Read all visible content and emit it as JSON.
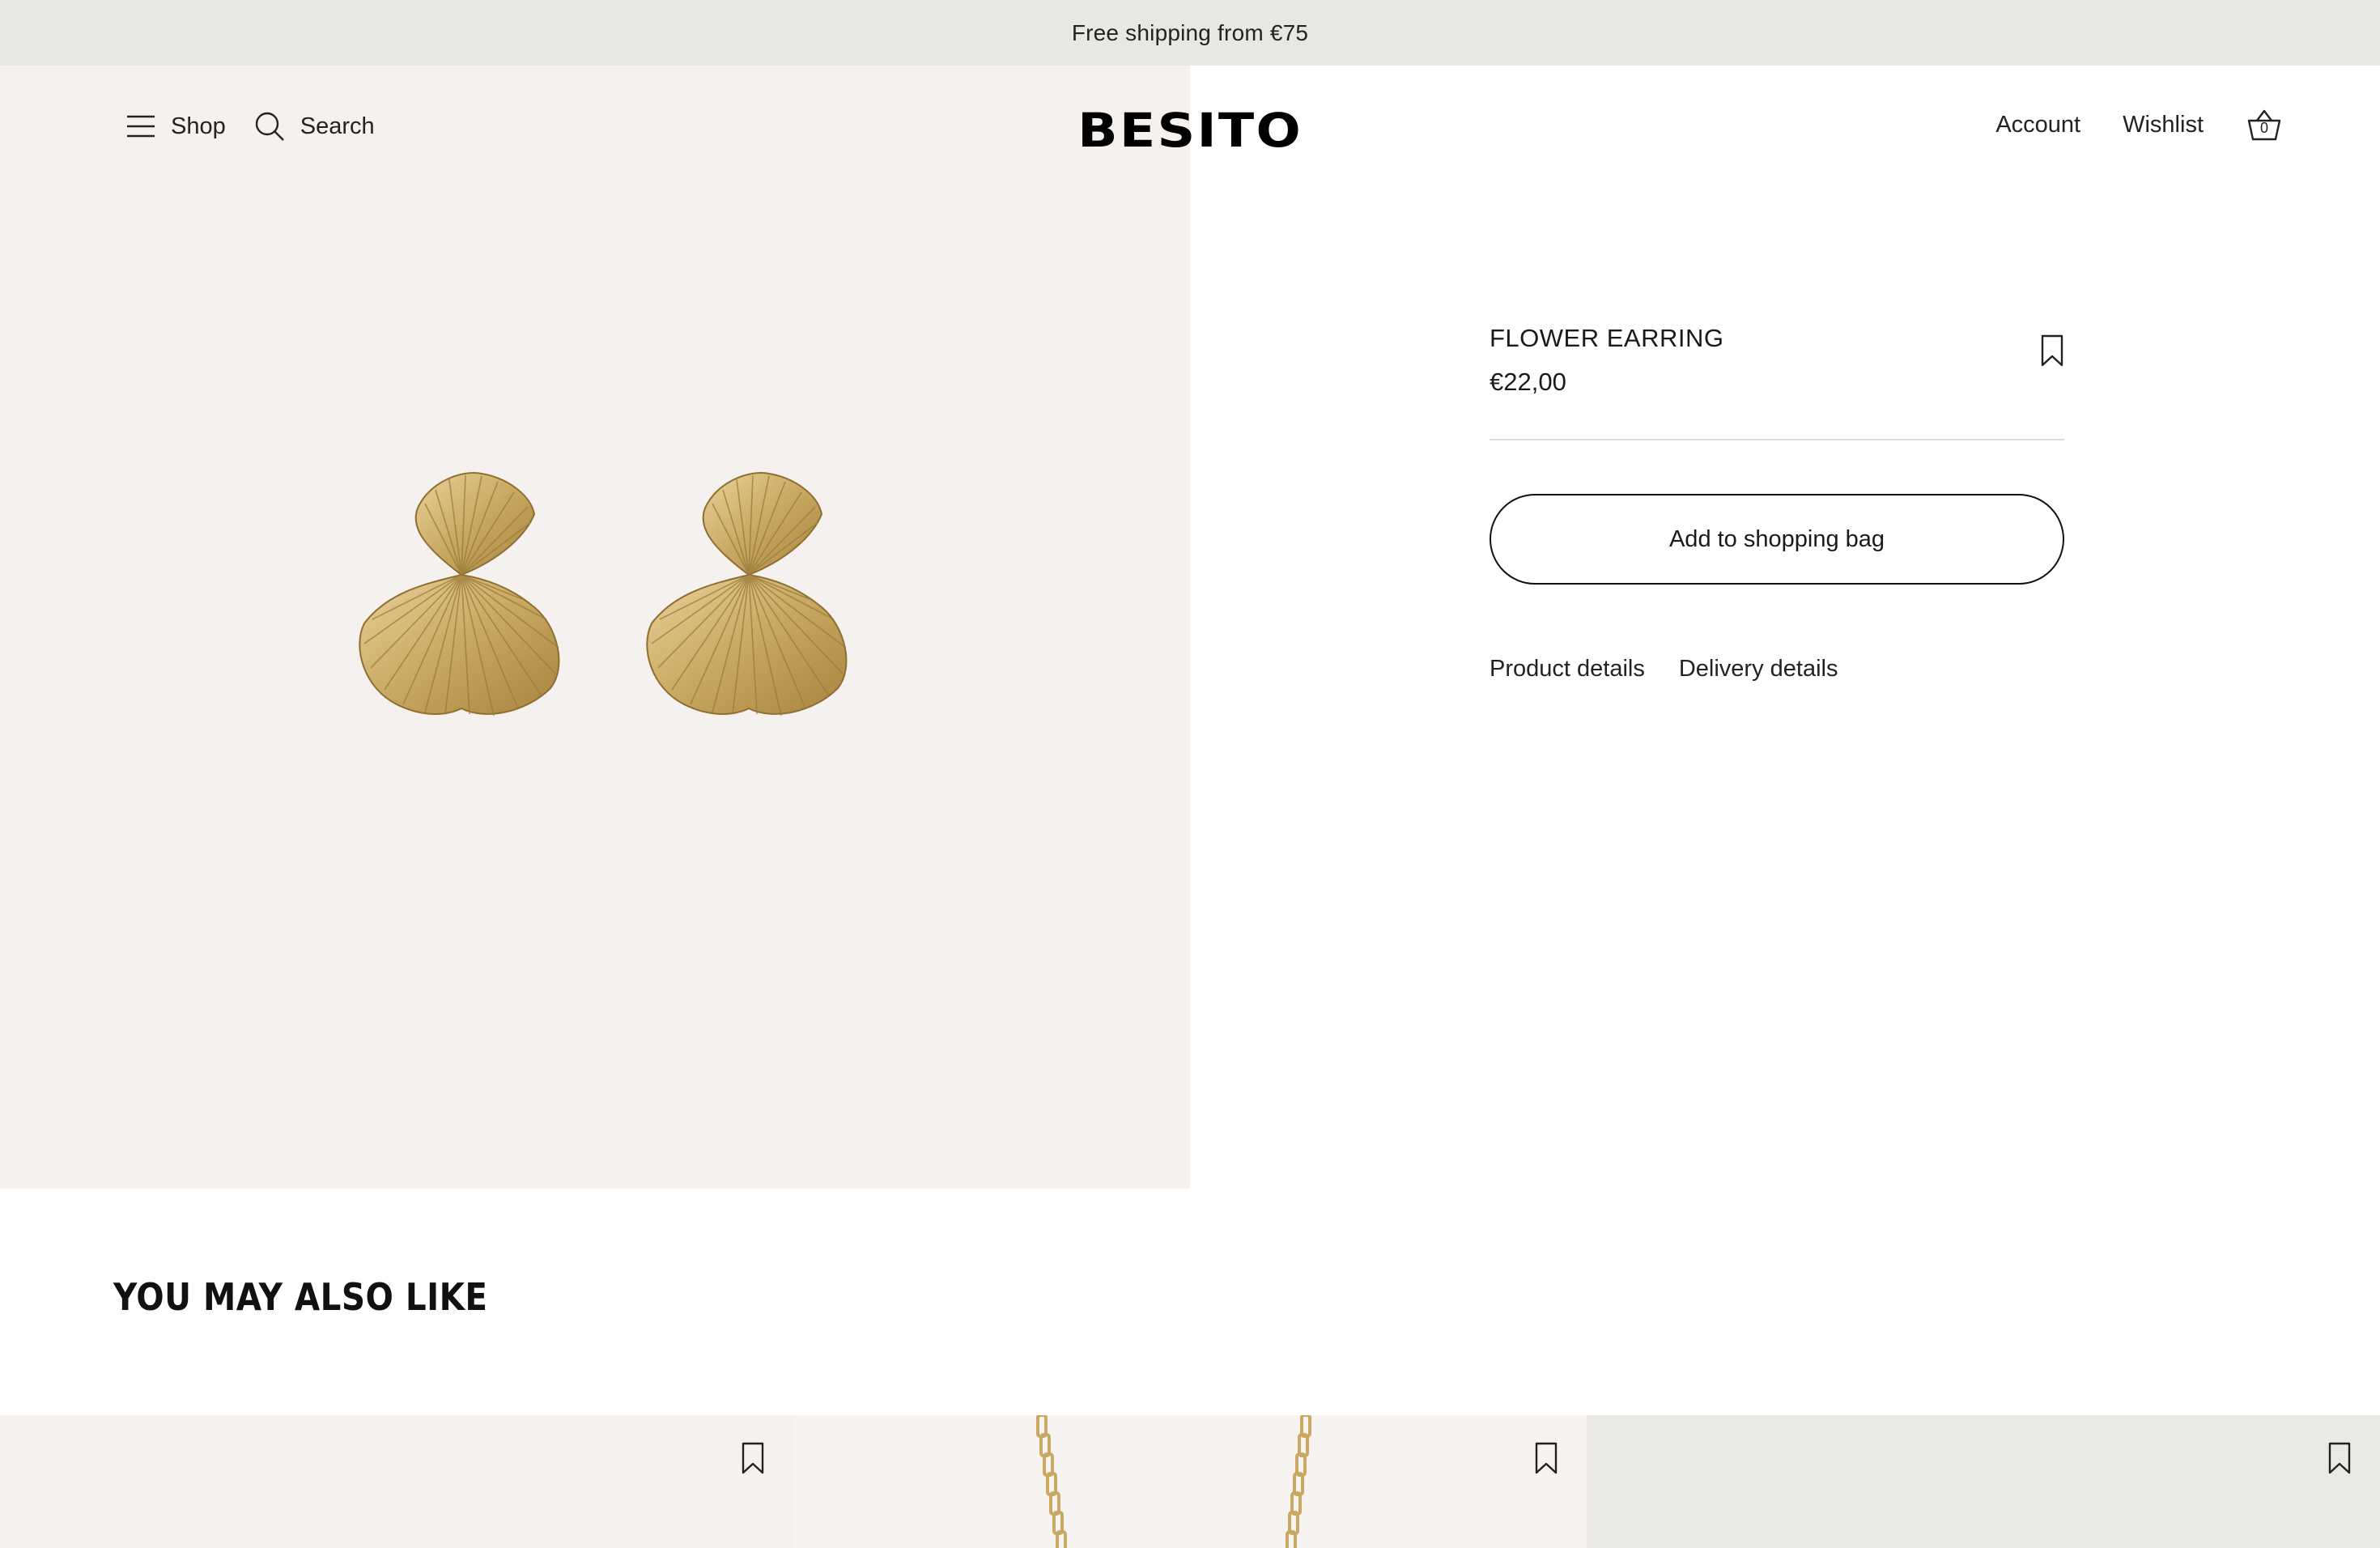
{
  "announcement": "Free shipping from €75",
  "header": {
    "shop_label": "Shop",
    "search_label": "Search",
    "logo": "BESITO",
    "account_label": "Account",
    "wishlist_label": "Wishlist",
    "cart_count": "0"
  },
  "product": {
    "title": "FLOWER EARRING",
    "price": "€22,00",
    "add_button": "Add to shopping bag",
    "tabs": [
      "Product details",
      "Delivery details"
    ]
  },
  "recommendations": {
    "heading": "YOU MAY ALSO LIKE",
    "items": [
      {
        "icon": "bookmark-icon"
      },
      {
        "icon": "bookmark-icon"
      },
      {
        "icon": "bookmark-icon"
      }
    ]
  },
  "colors": {
    "announcement_bg": "#e9e7e3",
    "product_bg": "#f5f1ee",
    "gold": "#c9a861",
    "text": "#1a1a1a"
  }
}
